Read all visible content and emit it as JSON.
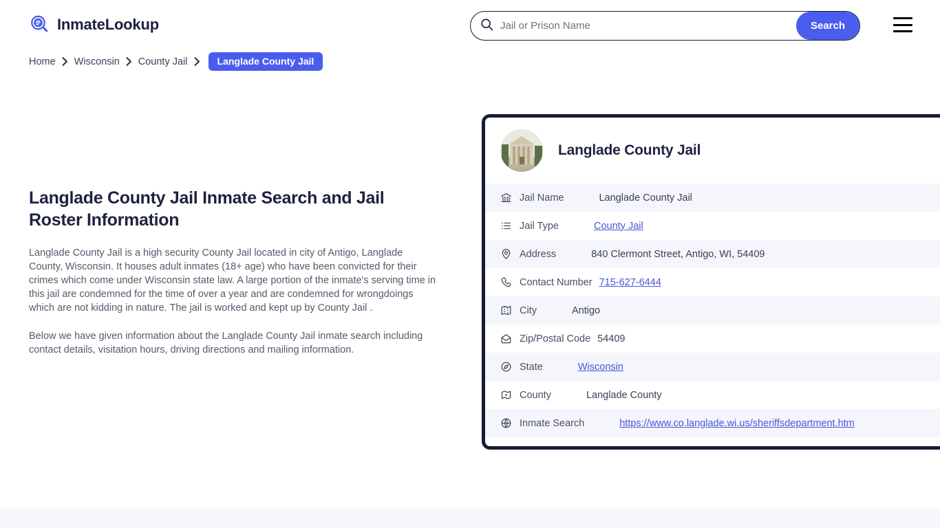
{
  "header": {
    "brand_name": "InmateLookup",
    "brand_icon": "magnifier-list-icon",
    "search": {
      "placeholder": "Jail or Prison Name",
      "value": "",
      "button_label": "Search",
      "icon": "search-icon"
    },
    "menu_icon": "hamburger-menu-icon"
  },
  "breadcrumb": {
    "items": [
      {
        "label": "Home"
      },
      {
        "label": "Wisconsin"
      },
      {
        "label": "County Jail"
      }
    ],
    "current": "Langlade County Jail",
    "separator": "chevron-right-icon"
  },
  "main": {
    "title": "Langlade County Jail Inmate Search and Jail Roster Information",
    "paragraphs": [
      "Langlade County Jail is a high security County Jail located in city of Antigo, Langlade County, Wisconsin. It houses adult inmates (18+ age) who have been convicted for their crimes which come under Wisconsin state law. A large portion of the inmate's serving time in this jail are condemned for the time of over a year and are condemned for wrongdoings which are not kidding in nature. The jail is worked and kept up by County Jail .",
      "Below we have given information about the Langlade County Jail inmate search including contact details, visitation hours, driving directions and mailing information."
    ]
  },
  "card": {
    "title": "Langlade County Jail",
    "avatar_alt": "courthouse-photo",
    "rows": [
      {
        "icon": "bank-icon",
        "label": "Jail Name",
        "value": "Langlade County Jail",
        "link": false
      },
      {
        "icon": "list-icon",
        "label": "Jail Type",
        "value": "County Jail",
        "link": true
      },
      {
        "icon": "map-pin-icon",
        "label": "Address",
        "value": "840 Clermont Street, Antigo, WI, 54409",
        "link": false
      },
      {
        "icon": "phone-icon",
        "label": "Contact Number",
        "value": "715-627-6444",
        "link": true
      },
      {
        "icon": "map-icon",
        "label": "City",
        "value": "Antigo",
        "link": false
      },
      {
        "icon": "envelope-icon",
        "label": "Zip/Postal Code",
        "value": "54409",
        "link": false
      },
      {
        "icon": "compass-icon",
        "label": "State",
        "value": "Wisconsin",
        "link": true
      },
      {
        "icon": "county-map-icon",
        "label": "County",
        "value": "Langlade County",
        "link": false
      },
      {
        "icon": "globe-icon",
        "label": "Inmate Search",
        "value": "https://www.co.langlade.wi.us/sheriffsdepartment.htm",
        "link": true
      }
    ]
  },
  "colors": {
    "accent": "#4a5ded",
    "link": "#4a55d8",
    "card_border": "#151c33",
    "row_alt": "#f5f5fc",
    "heading": "#1e2240",
    "body_text": "#555a6b",
    "bottom_band": "#f6f6fd"
  }
}
